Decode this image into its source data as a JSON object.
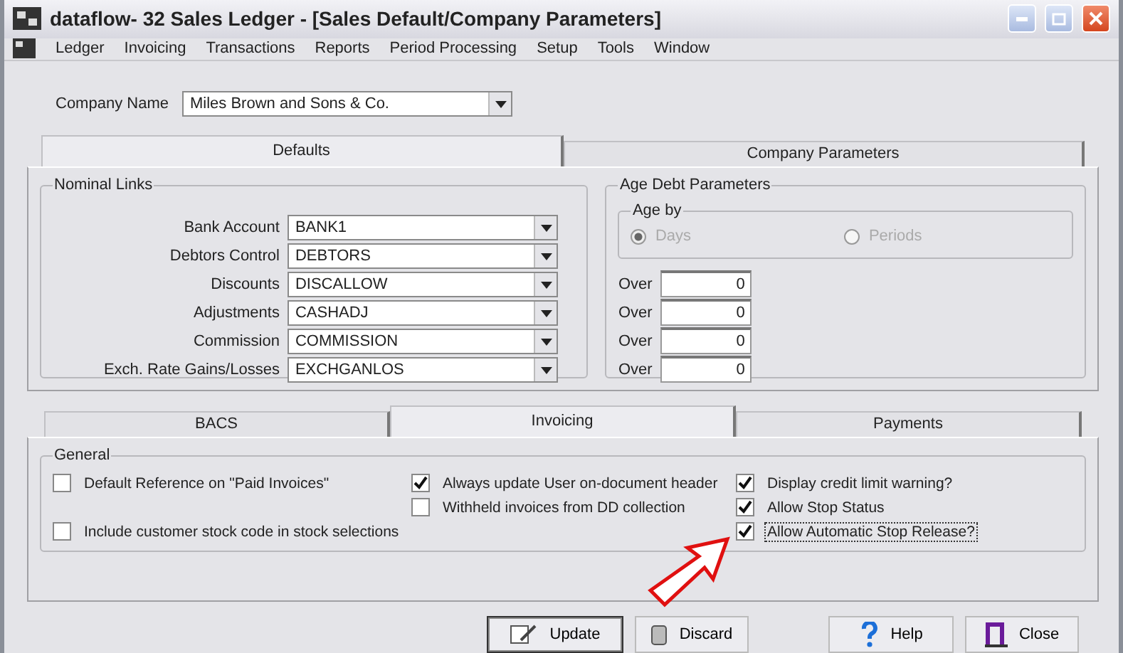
{
  "window": {
    "title": "dataflow- 32 Sales Ledger - [Sales Default/Company Parameters]"
  },
  "menu": [
    "Ledger",
    "Invoicing",
    "Transactions",
    "Reports",
    "Period Processing",
    "Setup",
    "Tools",
    "Window"
  ],
  "company": {
    "label": "Company Name",
    "value": "Miles Brown and Sons & Co."
  },
  "top_tabs": [
    {
      "label": "Defaults",
      "selected": true
    },
    {
      "label": "Company Parameters",
      "selected": false
    }
  ],
  "nominal_links": {
    "title": "Nominal Links",
    "rows": [
      {
        "label": "Bank Account",
        "value": "BANK1"
      },
      {
        "label": "Debtors Control",
        "value": "DEBTORS"
      },
      {
        "label": "Discounts",
        "value": "DISCALLOW"
      },
      {
        "label": "Adjustments",
        "value": "CASHADJ"
      },
      {
        "label": "Commission",
        "value": "COMMISSION"
      },
      {
        "label": "Exch. Rate Gains/Losses",
        "value": "EXCHGANLOS"
      }
    ]
  },
  "age_debt": {
    "title": "Age Debt Parameters",
    "age_by": {
      "title": "Age by",
      "options": [
        {
          "label": "Days",
          "selected": true,
          "disabled": true
        },
        {
          "label": "Periods",
          "selected": false,
          "disabled": true
        }
      ]
    },
    "over": [
      {
        "label": "Over",
        "value": "0"
      },
      {
        "label": "Over",
        "value": "0"
      },
      {
        "label": "Over",
        "value": "0"
      },
      {
        "label": "Over",
        "value": "0"
      }
    ]
  },
  "bottom_tabs": [
    {
      "label": "BACS",
      "selected": false
    },
    {
      "label": "Invoicing",
      "selected": true
    },
    {
      "label": "Payments",
      "selected": false
    }
  ],
  "general": {
    "title": "General",
    "columns": [
      [
        {
          "label": "Default Reference on \"Paid Invoices\"",
          "checked": false
        },
        {
          "label": "Include customer stock code in stock selections",
          "checked": false
        }
      ],
      [
        {
          "label": "Always update User on-document header",
          "checked": true
        },
        {
          "label": "Withheld invoices from DD collection",
          "checked": false
        }
      ],
      [
        {
          "label": "Display credit limit warning?",
          "checked": true
        },
        {
          "label": "Allow Stop Status",
          "checked": true
        },
        {
          "label": "Allow Automatic Stop Release?",
          "checked": true,
          "focused": true
        }
      ]
    ]
  },
  "buttons": [
    {
      "label": "Update",
      "kind": "update",
      "default": true
    },
    {
      "label": "Discard",
      "kind": "discard",
      "default": false
    },
    {
      "label": "Help",
      "kind": "help",
      "default": false
    },
    {
      "label": "Close",
      "kind": "close",
      "default": false
    }
  ]
}
